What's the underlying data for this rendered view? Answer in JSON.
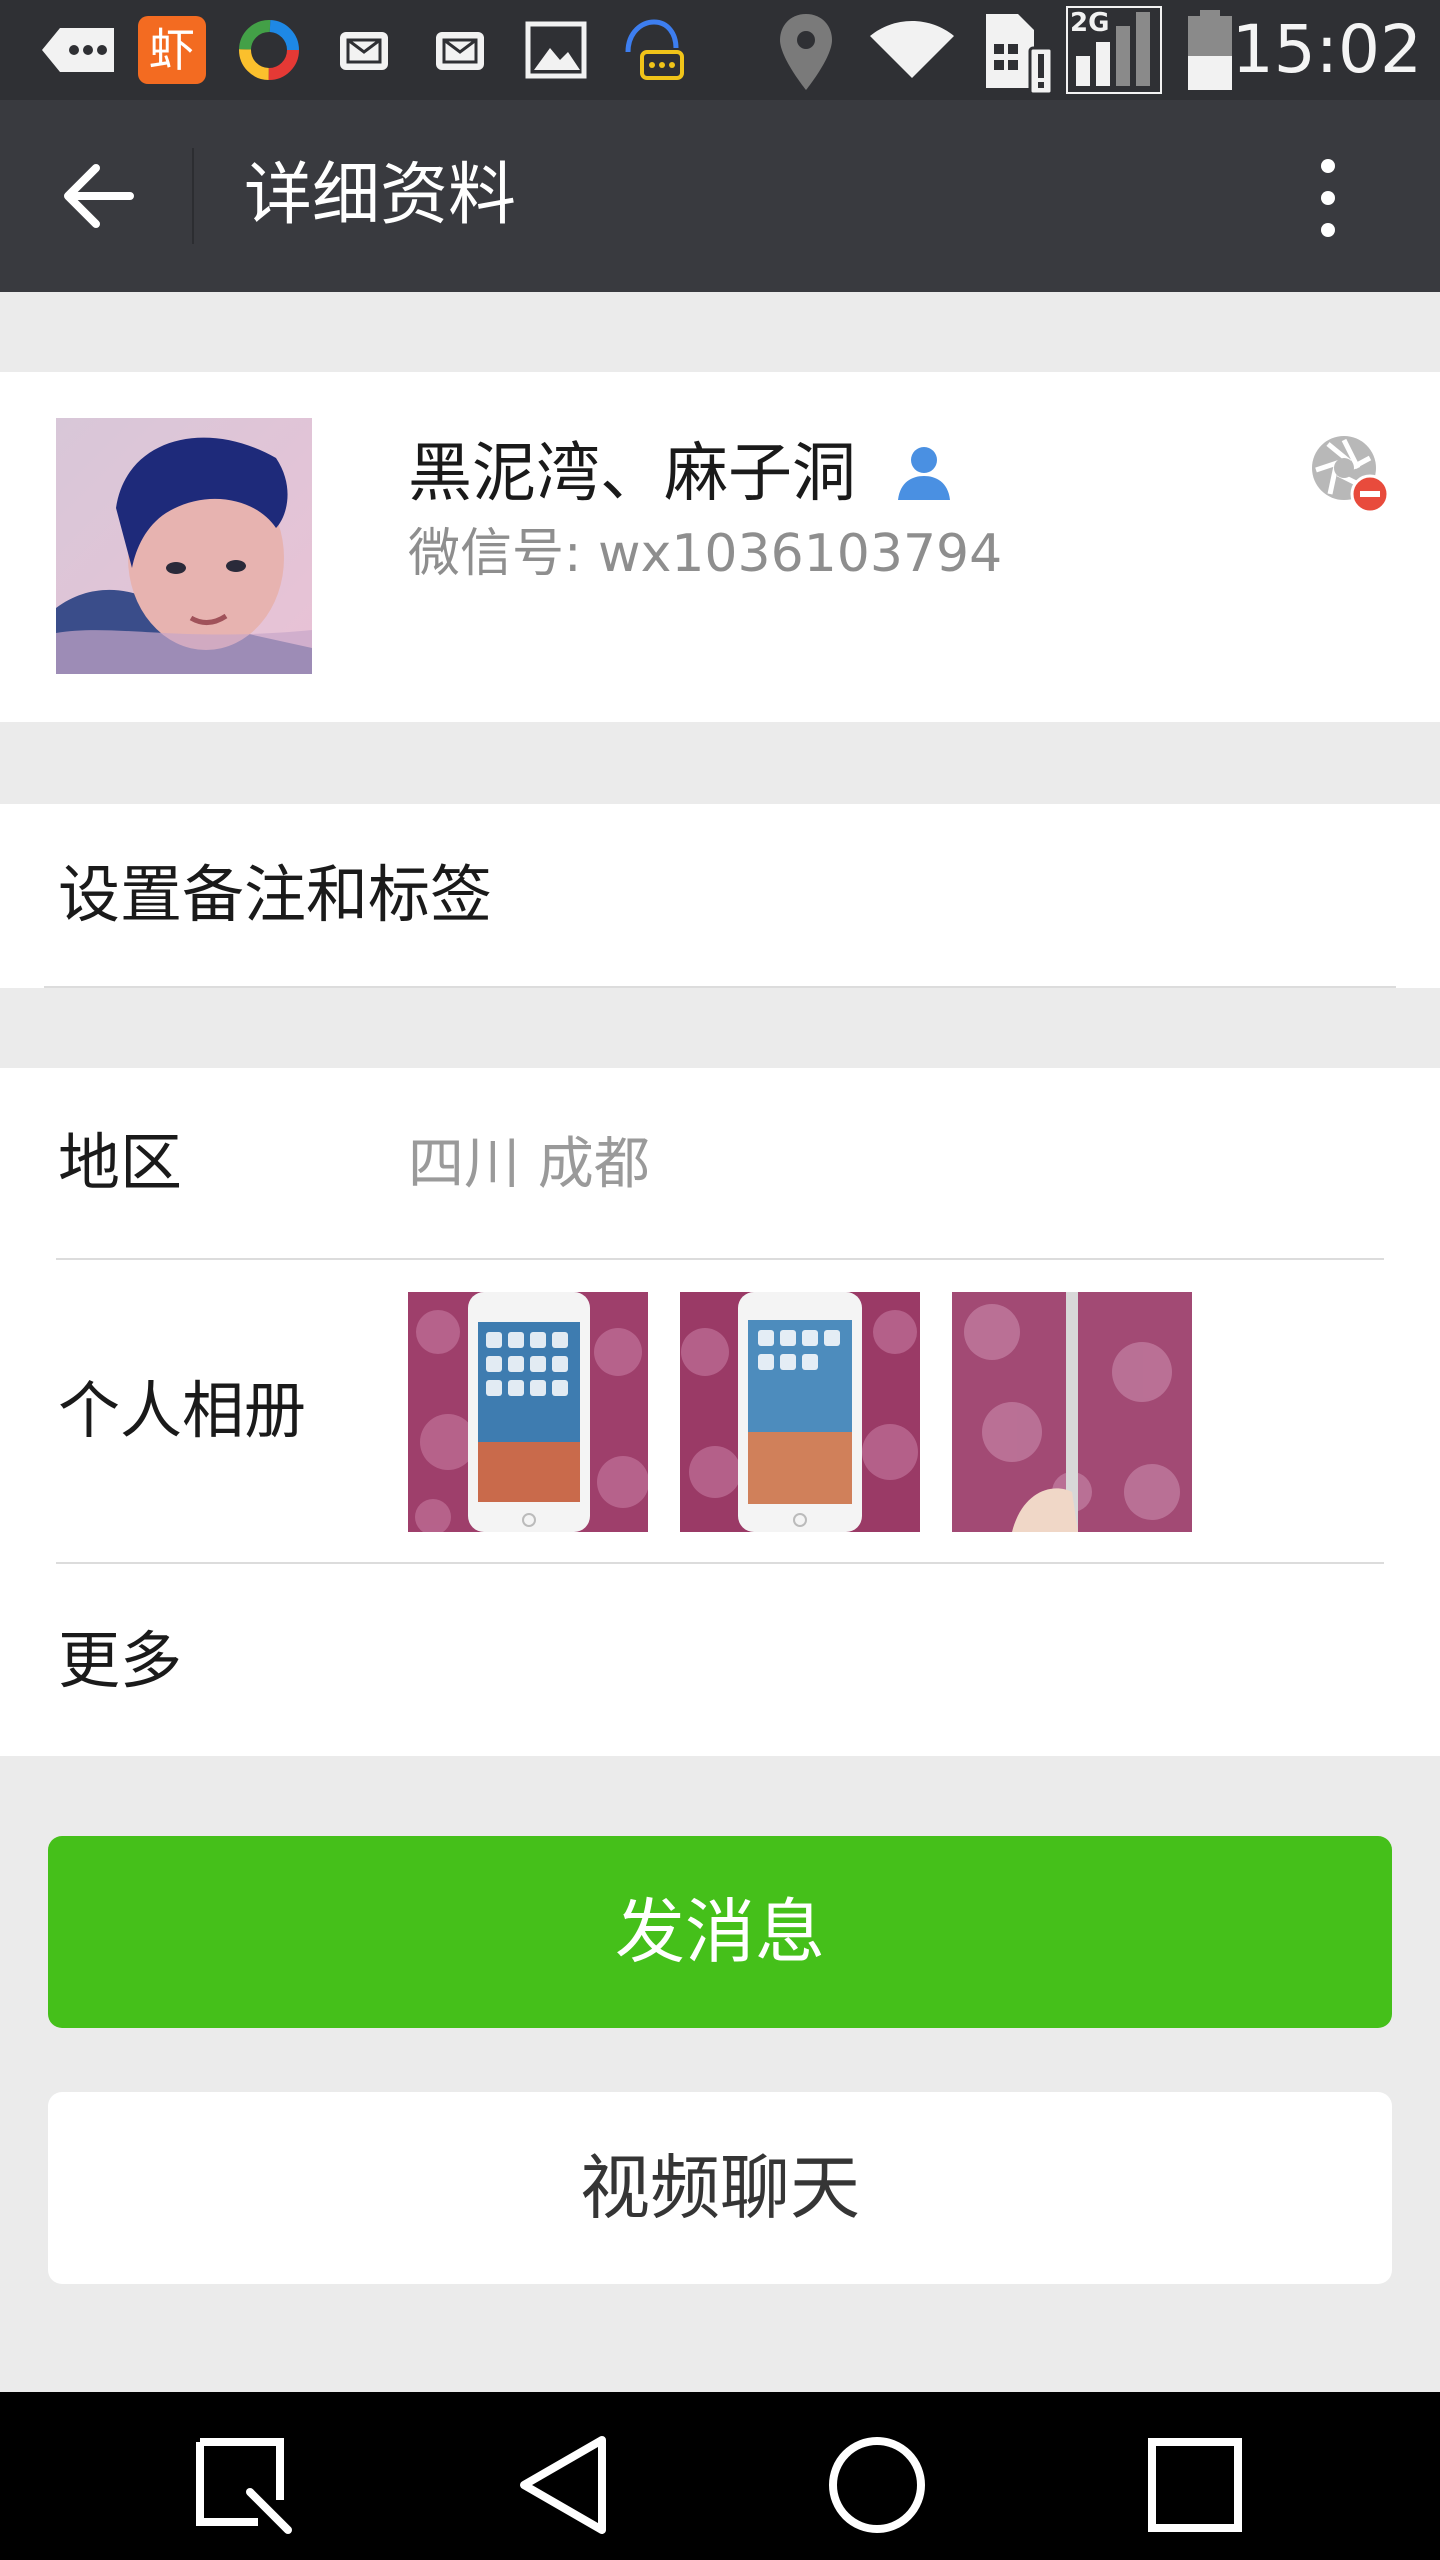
{
  "status_bar": {
    "time": "15:02",
    "network": "2G",
    "app_badge_char": "虾",
    "icons": [
      "back-notification-icon",
      "xiami-app-icon",
      "colorful-app-icon",
      "mail-icon",
      "mail-icon",
      "image-icon",
      "chat-support-icon",
      "location-icon",
      "wifi-icon",
      "sim-alert-icon",
      "signal-icon",
      "battery-icon"
    ]
  },
  "app_bar": {
    "title": "详细资料",
    "back_icon": "back-arrow-icon",
    "more_icon": "more-vert-icon"
  },
  "profile": {
    "name": "黑泥湾、麻子洞",
    "wechat_id": "微信号: wx1036103794",
    "contact_icon": "contact-person-icon",
    "moments_blocked_icon": "moments-blocked-icon"
  },
  "remark_row": {
    "label": "设置备注和标签"
  },
  "info": {
    "region_label": "地区",
    "region_value": "四川  成都",
    "album_label": "个人相册",
    "album_photo_count": 3,
    "more_label": "更多"
  },
  "actions": {
    "send_message": "发消息",
    "video_chat": "视频聊天"
  },
  "colors": {
    "status_bar": "#2f3034",
    "app_bar": "#393a3f",
    "primary_green": "#45c01a",
    "background": "#ebebeb",
    "contact_icon_blue": "#4a90e2"
  },
  "nav_bar": {
    "icons": [
      "recent-search-icon",
      "nav-back-icon",
      "home-icon",
      "overview-icon"
    ]
  }
}
